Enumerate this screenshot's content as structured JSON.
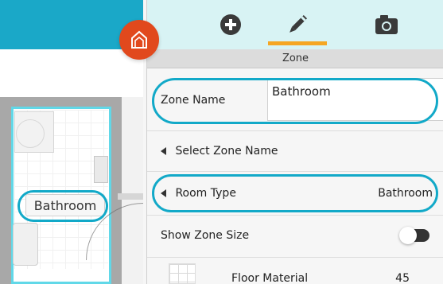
{
  "colors": {
    "app_teal": "#1aa8c8",
    "toolbar_bg": "#d8f3f4",
    "active_tab_indicator": "#f5a623",
    "logo_orange": "#e1491d",
    "highlight_oval": "#12a9c8",
    "room_outline": "#61d8e8"
  },
  "toolbar": {
    "buttons": [
      {
        "name": "add",
        "icon": "plus-circle-icon",
        "active": false
      },
      {
        "name": "edit",
        "icon": "pencil-icon",
        "active": true
      },
      {
        "name": "camera",
        "icon": "camera-icon",
        "active": false
      }
    ]
  },
  "app": {
    "logo_icon": "house-icon"
  },
  "canvas": {
    "room_label": "Bathroom"
  },
  "panel": {
    "section_title": "Zone",
    "zone_name": {
      "label": "Zone Name",
      "value": "Bathroom"
    },
    "select_zone_name": {
      "label": "Select Zone Name"
    },
    "room_type": {
      "label": "Room Type",
      "value": "Bathroom"
    },
    "show_zone_size": {
      "label": "Show Zone Size",
      "enabled": false
    },
    "floor_material": {
      "label": "Floor Material",
      "value": "45"
    }
  }
}
